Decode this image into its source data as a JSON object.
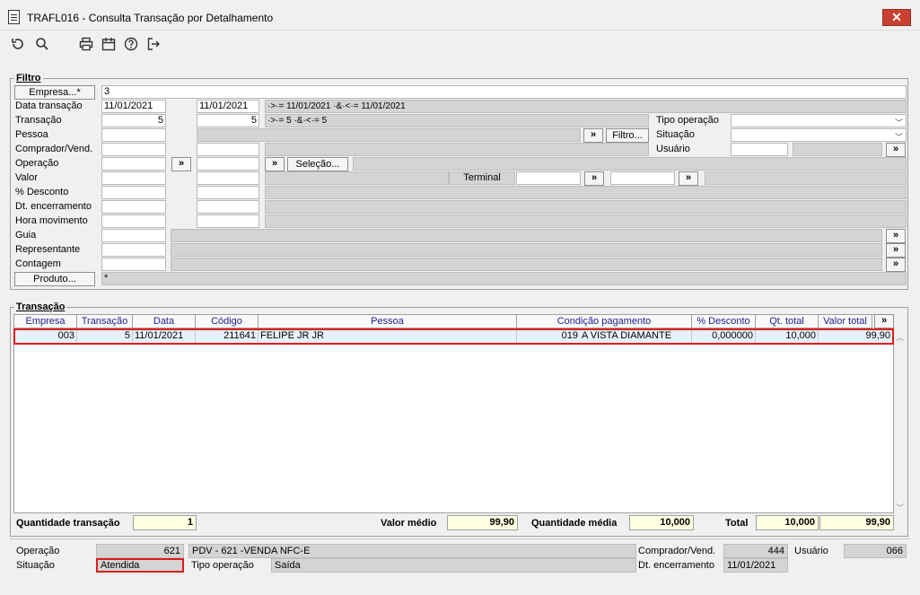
{
  "window": {
    "title": "TRAFL016 - Consulta Transação por Detalhamento",
    "close": "✕"
  },
  "toolbar": {
    "icons": [
      "refresh-icon",
      "search-icon",
      "print-icon",
      "calendar-icon",
      "help-icon",
      "exit-icon"
    ]
  },
  "filtro": {
    "title": "Filtro",
    "empresa_btn": "Empresa...*",
    "empresa_value": "3",
    "labels": [
      "Data transação",
      "Transação",
      "Pessoa",
      "Comprador/Vend.",
      "Operação",
      "Valor",
      "% Desconto",
      "Dt. encerramento",
      "Hora movimento",
      "Guia",
      "Representante",
      "Contagem"
    ],
    "produto_btn": "Produto...",
    "produto_value": "*",
    "data_de": "11/01/2021",
    "data_ate": "11/01/2021",
    "data_expr": "·>·= 11/01/2021  ·&·<·= 11/01/2021",
    "trans_de": "5",
    "trans_ate": "5",
    "trans_expr": "·>·= 5  ·&·<·= 5",
    "tipo_operacao_label": "Tipo operação",
    "situacao_label": "Situação",
    "usuario_label": "Usuário",
    "filtro_btn": "Filtro...",
    "selecao_btn": "Seleção...",
    "terminal_label": "Terminal",
    "more": "»"
  },
  "transacao": {
    "title": "Transação",
    "columns": [
      "Empresa",
      "Transação",
      "Data",
      "Código",
      "Pessoa",
      "Condição pagamento",
      "% Desconto",
      "Qt. total",
      "Valor total"
    ],
    "more": "»",
    "rows": [
      {
        "empresa": "003",
        "transacao": "5",
        "data": "11/01/2021",
        "codigo": "211641",
        "pessoa": "FELIPE JR JR",
        "cond_cod": "019",
        "cond_desc": "A VISTA DIAMANTE",
        "desconto": "0,000000",
        "qt_total": "10,000",
        "valor_total": "99,90"
      }
    ]
  },
  "totals": {
    "qtd_transacao_label": "Quantidade transação",
    "qtd_transacao": "1",
    "valor_medio_label": "Valor médio",
    "valor_medio": "99,90",
    "qtd_media_label": "Quantidade média",
    "qtd_media": "10,000",
    "total_label": "Total",
    "total_qt": "10,000",
    "total_valor": "99,90"
  },
  "detail": {
    "operacao_label": "Operação",
    "operacao_cod": "621",
    "operacao_desc": "PDV - 621 -VENDA NFC-E",
    "situacao_label": "Situação",
    "situacao_value": "Atendida",
    "tipo_operacao_label": "Tipo operação",
    "tipo_operacao_value": "Saída",
    "comprador_label": "Comprador/Vend.",
    "comprador_value": "444",
    "usuario_label": "Usuário",
    "usuario_value": "066",
    "dt_enc_label": "Dt. encerramento",
    "dt_enc_value": "11/01/2021"
  },
  "colors": {
    "highlight": "#e01b1b",
    "close_red": "#c84031",
    "grid_header_text": "#1f1f8f"
  }
}
